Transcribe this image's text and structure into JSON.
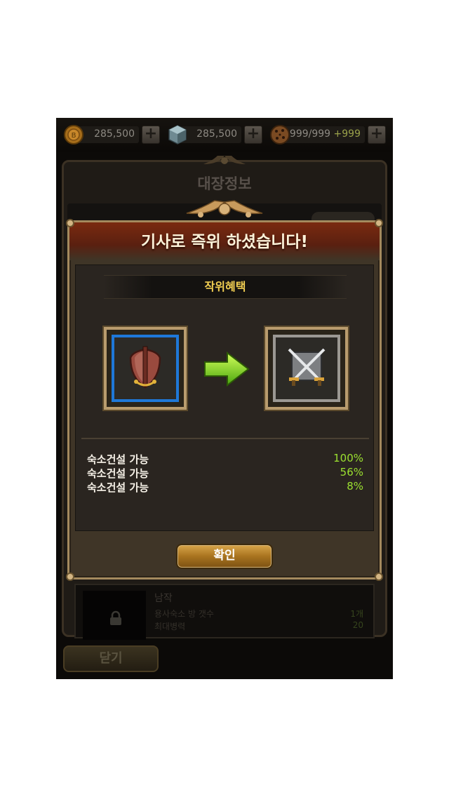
{
  "resources": [
    {
      "icon": "gold-coin-icon",
      "value": "285,500"
    },
    {
      "icon": "crystal-icon",
      "value": "285,500"
    },
    {
      "icon": "cookie-icon",
      "value": "999/999",
      "bonus": "+999"
    }
  ],
  "background": {
    "title": "대장정보",
    "slot": {
      "name": "남작",
      "row1_label": "용사숙소 방 갯수",
      "row1_value": "1개",
      "row2_label": "최대병력",
      "row2_value": "20"
    },
    "close_label": "닫기"
  },
  "dialog": {
    "title": "기사로 즉위 하셨습니다!",
    "section_title": "작위혜택",
    "from_icon": "shield-emblem-icon",
    "to_icon": "crossed-swords-emblem-icon",
    "benefits": [
      {
        "label": "숙소건설 가능",
        "value": "100%"
      },
      {
        "label": "숙소건설 가능",
        "value": "56%"
      },
      {
        "label": "숙소건설 가능",
        "value": "8%"
      }
    ],
    "confirm_label": "확인"
  },
  "colors": {
    "title_banner": "#7a2a10",
    "section_title": "#f2cf52",
    "percent": "#9be030",
    "from_frame": "#1f78d8",
    "to_frame": "#9b9893"
  }
}
